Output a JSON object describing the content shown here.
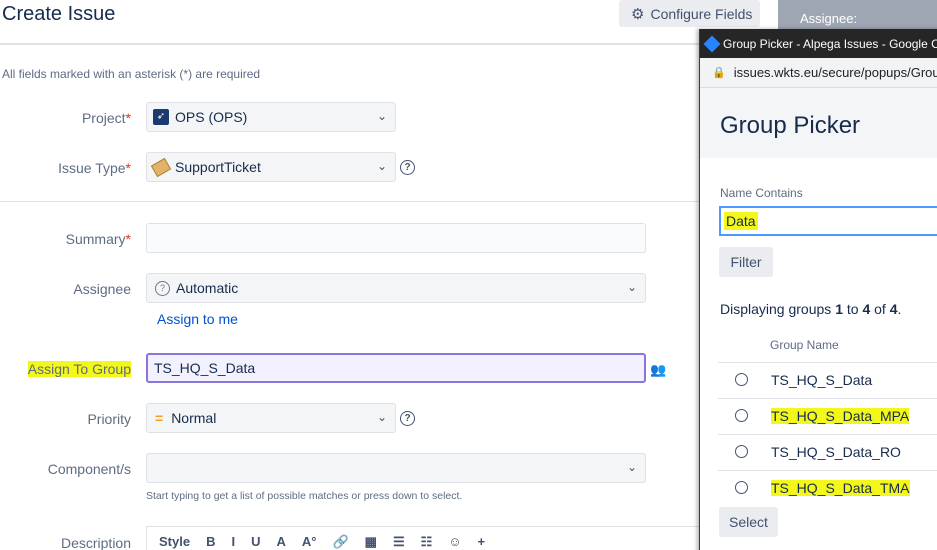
{
  "dialog": {
    "title": "Create Issue",
    "configure_fields": "Configure Fields",
    "required_note": "All fields marked with an asterisk (*) are required"
  },
  "fields": {
    "project": {
      "label": "Project",
      "value": "OPS (OPS)"
    },
    "issue_type": {
      "label": "Issue Type",
      "value": "SupportTicket"
    },
    "summary": {
      "label": "Summary",
      "value": ""
    },
    "assignee": {
      "label": "Assignee",
      "value": "Automatic",
      "assign_to_me": "Assign to me"
    },
    "assign_to_group": {
      "label": "Assign To Group",
      "value": "TS_HQ_S_Data"
    },
    "priority": {
      "label": "Priority",
      "value": "Normal"
    },
    "components": {
      "label": "Component/s",
      "hint": "Start typing to get a list of possible matches or press down to select."
    },
    "description": {
      "label": "Description",
      "toolbar": [
        "Style",
        "B",
        "I",
        "U",
        "A",
        "A°",
        "🔗",
        "▦",
        "☰",
        "☷",
        "☺",
        "+"
      ]
    },
    "required_star": "*"
  },
  "background": {
    "assignee_label": "Assignee:"
  },
  "popup": {
    "window_title": "Group Picker - Alpega Issues - Google Chrome",
    "url": "issues.wkts.eu/secure/popups/GroupPickerBrowser.jspa",
    "heading": "Group Picker",
    "name_contains_label": "Name Contains",
    "name_contains_value": "Data",
    "filter_button": "Filter",
    "display": {
      "prefix": "Displaying groups",
      "from": "1",
      "to_word": "to",
      "to": "4",
      "of_word": "of",
      "total": "4"
    },
    "column_header": "Group Name",
    "groups": [
      "TS_HQ_S_Data",
      "TS_HQ_S_Data_MPA",
      "TS_HQ_S_Data_RO",
      "TS_HQ_S_Data_TMA"
    ],
    "select_button": "Select"
  },
  "icons": {
    "gear": "gear-icon",
    "help": "help-icon",
    "group_picker": "group-picker-icon",
    "lock": "lock-icon"
  },
  "colors": {
    "highlight": "#f4f81a",
    "link": "#0052cc",
    "focus_border": "#8777d9"
  }
}
